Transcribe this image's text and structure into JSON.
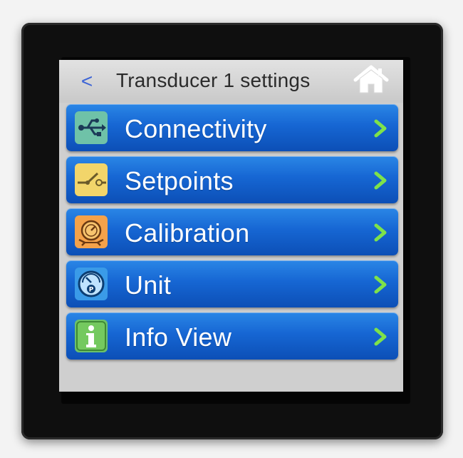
{
  "header": {
    "back_label": "<",
    "title": "Transducer 1 settings"
  },
  "menu": {
    "items": [
      {
        "label": "Connectivity",
        "icon": "usb-icon",
        "icon_color": "#6fc2a8"
      },
      {
        "label": "Setpoints",
        "icon": "setpoint-switch-icon",
        "icon_color": "#f2d56a"
      },
      {
        "label": "Calibration",
        "icon": "calibration-gauge-icon",
        "icon_color": "#f4a24a"
      },
      {
        "label": "Unit",
        "icon": "pressure-unit-icon",
        "icon_color": "#3a9be8"
      },
      {
        "label": "Info View",
        "icon": "info-icon",
        "icon_color": "#6cc26a"
      }
    ]
  },
  "colors": {
    "accent_chevron": "#7ee24a",
    "button_blue": "#1666d3",
    "back_arrow": "#3b63d6"
  }
}
